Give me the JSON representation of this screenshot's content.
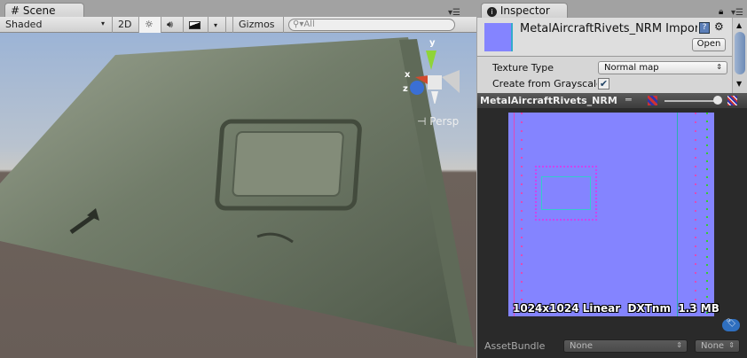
{
  "scene": {
    "tab_label": "Scene",
    "shading_mode": "Shaded",
    "btn_2d": "2D",
    "gizmos_label": "Gizmos",
    "search_placeholder": "All",
    "projection_label": "Persp",
    "gizmo_axes": {
      "x": "x",
      "y": "y",
      "z": "z"
    }
  },
  "inspector": {
    "tab_label": "Inspector",
    "asset_title": "MetalAircraftRivets_NRM Import",
    "open_button": "Open",
    "properties": [
      {
        "label": "Texture Type",
        "value": "Normal map"
      },
      {
        "label": "Create from Grayscale",
        "checked": true
      }
    ],
    "preview_title": "MetalAircraftRivets_NRM",
    "preview_info": "1024x1024 Linear  DXTnm  1.3 MB",
    "preview_mip_level": 0.95,
    "assetbundle": {
      "label": "AssetBundle",
      "name": "None",
      "variant": "None"
    }
  },
  "colors": {
    "normal_map": "#8484ff",
    "sky": "#9db6d6",
    "ground": "#6d625b",
    "metal": "#6f7b68"
  }
}
